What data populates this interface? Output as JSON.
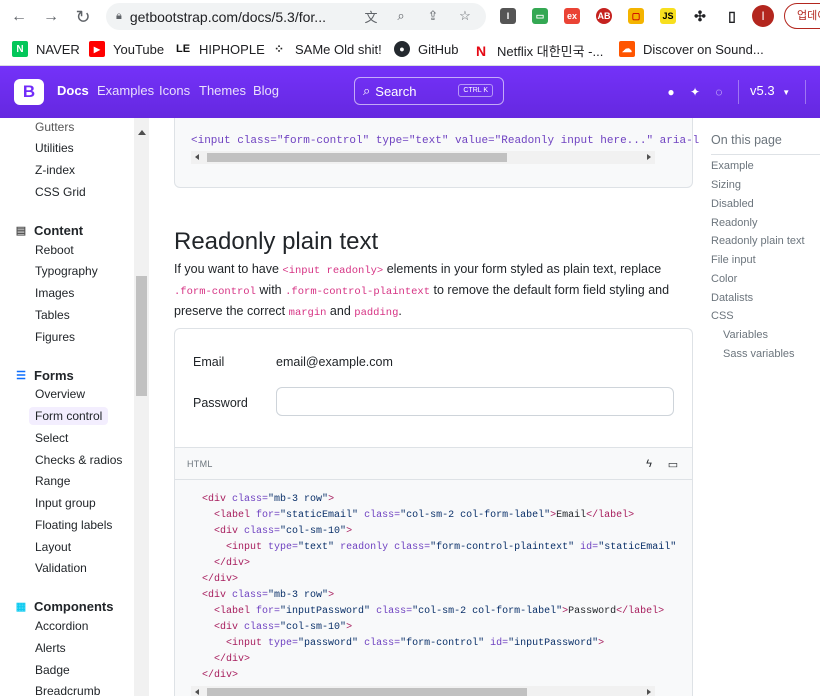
{
  "browser": {
    "url": "getbootstrap.com/docs/5.3/for...",
    "profile_initial": "I",
    "update_label": "업데이",
    "bookmarks": [
      {
        "label": "NAVER",
        "icon": "naver-icon",
        "color": "#03c75a",
        "glyph": "N"
      },
      {
        "label": "YouTube",
        "icon": "youtube-icon",
        "color": "#ff0000",
        "glyph": "▶"
      },
      {
        "label": "HIPHOPLE",
        "icon": "hiphople-icon",
        "color": "#111111",
        "glyph": "LE"
      },
      {
        "label": "SAMe Old shit!",
        "icon": "same-icon",
        "color": "#222222",
        "glyph": "⁘"
      },
      {
        "label": "GitHub",
        "icon": "github-icon",
        "color": "#24292f",
        "glyph": "●"
      },
      {
        "label": "Netflix 대한민국 -...",
        "icon": "netflix-icon",
        "color": "#e50914",
        "glyph": "N"
      },
      {
        "label": "Discover on Sound...",
        "icon": "soundcloud-icon",
        "color": "#ff5500",
        "glyph": "☁"
      }
    ]
  },
  "navbar": {
    "logo": "B",
    "links": [
      "Docs",
      "Examples",
      "Icons",
      "Themes",
      "Blog"
    ],
    "search_label": "Search",
    "search_kbd": "CTRL K",
    "version": "v5.3"
  },
  "sidebar": {
    "top_items": [
      "Gutters",
      "Utilities",
      "Z-index",
      "CSS Grid"
    ],
    "content_group": "Content",
    "content_items": [
      "Reboot",
      "Typography",
      "Images",
      "Tables",
      "Figures"
    ],
    "forms_group": "Forms",
    "forms_items": [
      "Overview",
      "Form control",
      "Select",
      "Checks & radios",
      "Range",
      "Input group",
      "Floating labels",
      "Layout",
      "Validation"
    ],
    "components_group": "Components",
    "components_items": [
      "Accordion",
      "Alerts",
      "Badge",
      "Breadcrumb"
    ]
  },
  "main": {
    "top_code": "<input class=\"form-control\" type=\"text\" value=\"Readonly input here...\" aria-label",
    "title": "Readonly plain text",
    "para": {
      "p1": "If you want to have ",
      "c1": "<input readonly>",
      "p2": " elements in your form styled as plain text, replace ",
      "c2": ".form-control",
      "p3": " with ",
      "c3": ".form-control-plaintext",
      "p4": " to remove the default form field styling and preserve the correct ",
      "c4": "margin",
      "p5": " and ",
      "c5": "padding",
      "p6": "."
    },
    "example": {
      "email_label": "Email",
      "email_value": "email@example.com",
      "password_label": "Password"
    },
    "code_header": "HTML"
  },
  "toc": {
    "title": "On this page",
    "items": [
      "Example",
      "Sizing",
      "Disabled",
      "Readonly",
      "Readonly plain text",
      "File input",
      "Color",
      "Datalists",
      "CSS"
    ],
    "sub_items": [
      "Variables",
      "Sass variables"
    ]
  }
}
